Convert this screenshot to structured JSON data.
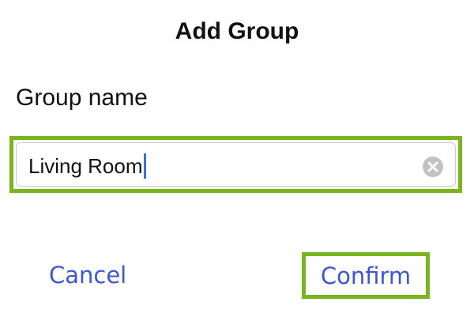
{
  "dialog": {
    "title": "Add Group",
    "field_label": "Group name",
    "input": {
      "value": "Living Room",
      "has_focus": true
    },
    "clear_icon": "clear-circle-icon",
    "buttons": {
      "cancel_label": "Cancel",
      "confirm_label": "Confirm"
    }
  },
  "colors": {
    "accent_link": "#3d57d3",
    "highlight_border": "#7ab51d",
    "caret": "#3b6fe0",
    "clear_icon_fill": "#c2c2c2"
  }
}
